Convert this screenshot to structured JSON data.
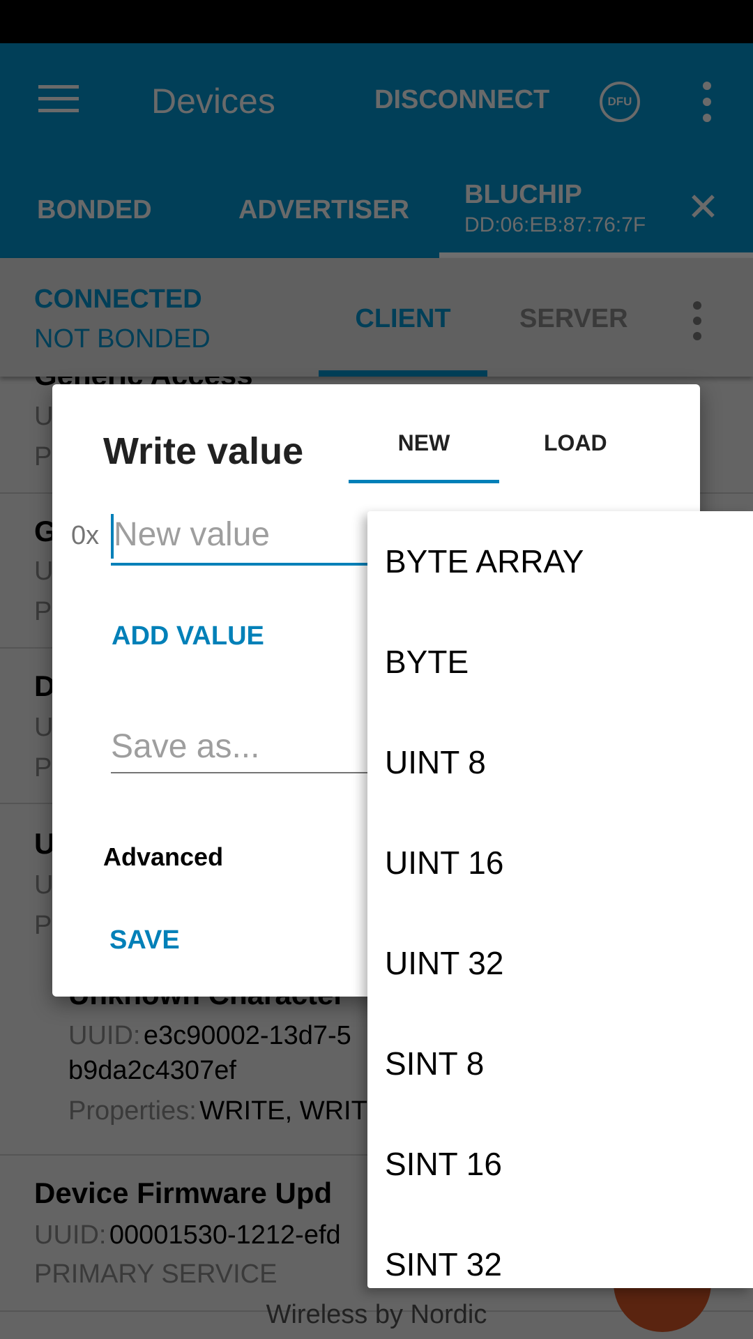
{
  "appbar": {
    "title": "Devices",
    "disconnect": "DISCONNECT",
    "dfu_icon_text": "DFU"
  },
  "tabs": [
    {
      "label": "BONDED"
    },
    {
      "label": "ADVERTISER"
    },
    {
      "label": "BLUCHIP",
      "sub": "DD:06:EB:87:76:7F"
    }
  ],
  "connection": {
    "state": "CONNECTED",
    "bond": "NOT BONDED",
    "tabs": [
      "CLIENT",
      "SERVER"
    ]
  },
  "list": {
    "frag": [
      "Generic Access",
      "U",
      "P",
      "G",
      "U",
      "P",
      "D",
      "U",
      "P",
      "U",
      "U",
      "P"
    ],
    "char_title": "Unknown Character",
    "char_uuid_label": "UUID:",
    "char_uuid": "e3c90002-13d7-5",
    "char_uuid2": "b9da2c4307ef",
    "char_props_label": "Properties:",
    "char_props": "WRITE, WRIT",
    "svc_title": "Device Firmware Upd",
    "svc_uuid_label": "UUID:",
    "svc_uuid": "00001530-1212-efd",
    "svc_type": "PRIMARY SERVICE",
    "footer": "Wireless by Nordic"
  },
  "dialog": {
    "title": "Write value",
    "tabs": [
      "NEW",
      "LOAD"
    ],
    "prefix": "0x",
    "value_placeholder": "New value",
    "add_value": "ADD VALUE",
    "save_as_placeholder": "Save as...",
    "advanced": "Advanced",
    "save": "SAVE"
  },
  "dropdown": {
    "options": [
      "BYTE ARRAY",
      "BYTE",
      "UINT 8",
      "UINT 16",
      "UINT 32",
      "SINT 8",
      "SINT 16",
      "SINT 32"
    ]
  },
  "colors": {
    "accent": "#0080b8",
    "appbar": "#013f58",
    "fab": "#5a2410"
  }
}
